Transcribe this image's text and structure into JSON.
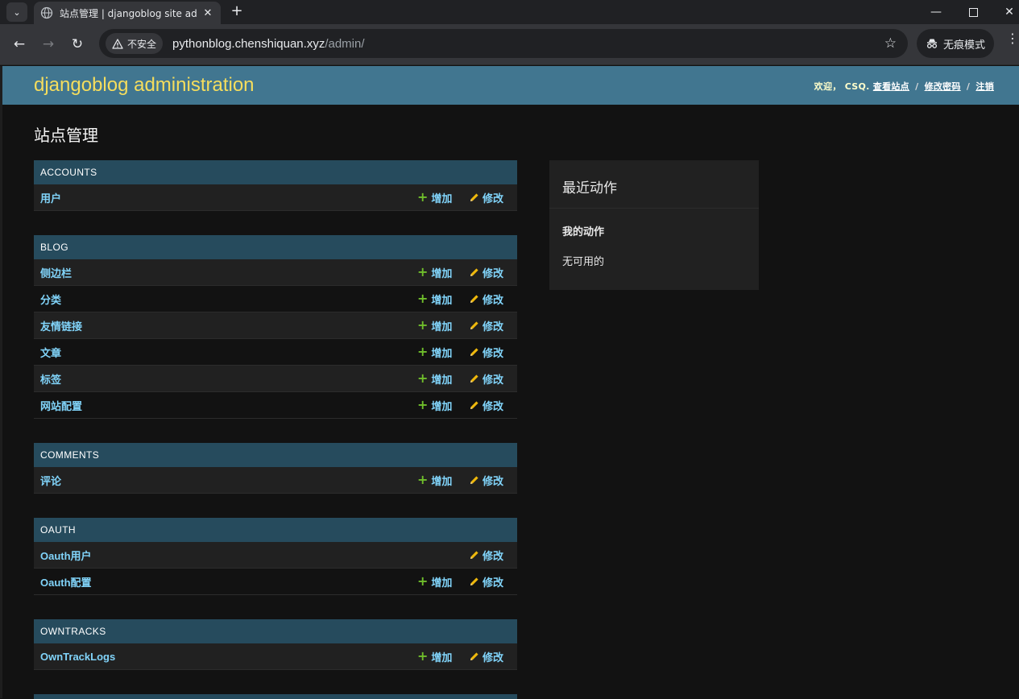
{
  "browser": {
    "tab_title": "站点管理 | djangoblog site ad",
    "security_label": "不安全",
    "url_host": "pythonblog.chenshiquan.xyz",
    "url_path": "/admin/",
    "incognito_label": "无痕模式"
  },
  "header": {
    "brand": "djangoblog administration",
    "welcome": "欢迎，",
    "username": "CSQ.",
    "view_site": "查看站点",
    "change_password": "修改密码",
    "logout": "注销",
    "separator": "/"
  },
  "page_title": "站点管理",
  "labels": {
    "add": "增加",
    "change": "修改"
  },
  "modules": [
    {
      "caption": "ACCOUNTS",
      "rows": [
        {
          "name": "用户",
          "add": true,
          "change": true
        }
      ]
    },
    {
      "caption": "BLOG",
      "rows": [
        {
          "name": "侧边栏",
          "add": true,
          "change": true
        },
        {
          "name": "分类",
          "add": true,
          "change": true
        },
        {
          "name": "友情链接",
          "add": true,
          "change": true
        },
        {
          "name": "文章",
          "add": true,
          "change": true
        },
        {
          "name": "标签",
          "add": true,
          "change": true
        },
        {
          "name": "网站配置",
          "add": true,
          "change": true
        }
      ]
    },
    {
      "caption": "COMMENTS",
      "rows": [
        {
          "name": "评论",
          "add": true,
          "change": true
        }
      ]
    },
    {
      "caption": "OAUTH",
      "rows": [
        {
          "name": "Oauth用户",
          "add": false,
          "change": true
        },
        {
          "name": "Oauth配置",
          "add": true,
          "change": true
        }
      ]
    },
    {
      "caption": "OWNTRACKS",
      "rows": [
        {
          "name": "OwnTrackLogs",
          "add": true,
          "change": true
        }
      ]
    }
  ],
  "recent_actions": {
    "title": "最近动作",
    "my_actions": "我的动作",
    "none_available": "无可用的"
  },
  "colors": {
    "header_bg": "#417690",
    "brand": "#f5dd5d",
    "caption_bg": "#264b5d",
    "link": "#81d4fa",
    "add_icon": "#70bf2b",
    "change_icon": "#efb80b"
  }
}
